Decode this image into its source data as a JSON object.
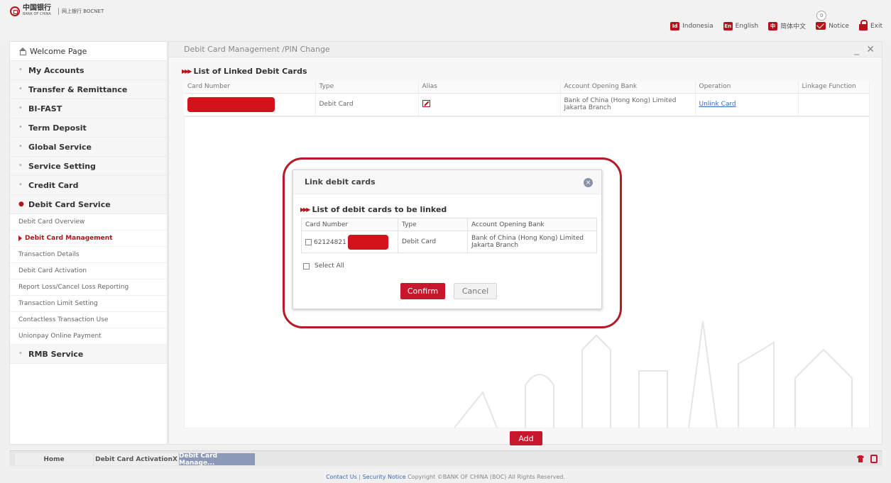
{
  "header": {
    "logo_cn": "中国银行",
    "logo_en": "BANK OF CHINA",
    "logo_sub": "网上银行 BOCNET",
    "notice_count": "0",
    "links": [
      {
        "badge": "Id",
        "label": "Indonesia"
      },
      {
        "badge": "En",
        "label": "English"
      },
      {
        "badge": "中",
        "label": "简体中文"
      }
    ],
    "notice_label": "Notice",
    "exit_label": "Exit"
  },
  "sidebar": {
    "welcome": "Welcome Page",
    "items": [
      "My Accounts",
      "Transfer & Remittance",
      "BI-FAST",
      "Term Deposit",
      "Global Service",
      "Service Setting",
      "Credit Card",
      "Debit Card Service"
    ],
    "sub_items": [
      "Debit Card Overview",
      "Debit Card Management",
      "Transaction Details",
      "Debit Card Activation",
      "Report Loss/Cancel Loss Reporting",
      "Transaction Limit Setting",
      "Contactless Transaction Use",
      "Unionpay Online Payment"
    ],
    "last_item": "RMB Service"
  },
  "main": {
    "breadcrumb": "Debit Card Management /PIN Change",
    "minimize": "_",
    "close": "✕",
    "section_title": "List of Linked Debit Cards",
    "columns": [
      "Card Number",
      "Type",
      "Alias",
      "Account Opening Bank",
      "Operation",
      "Linkage Function"
    ],
    "row": {
      "type": "Debit Card",
      "bank": "Bank of China (Hong Kong) Limited Jakarta Branch",
      "operation": "Unlink Card"
    },
    "add_button": "Add"
  },
  "modal": {
    "title": "Link debit cards",
    "close": "×",
    "section_title": "List of debit cards to be linked",
    "columns": [
      "Card Number",
      "Type",
      "Account Opening Bank"
    ],
    "row": {
      "card_prefix": "62124821",
      "type": "Debit Card",
      "bank": "Bank of China (Hong Kong) Limited Jakarta Branch"
    },
    "select_all": "Select All",
    "confirm": "Confirm",
    "cancel": "Cancel"
  },
  "tabs": {
    "home": "Home",
    "activation": "Debit Card ActivationX",
    "management": "Debit Card Manage..."
  },
  "footer": {
    "contact": "Contact Us",
    "separator": "|",
    "security": "Security Notice",
    "copyright": "Copyright ©BANK OF CHINA (BOC) All Rights Reserved."
  },
  "colors": {
    "brand_red": "#c8162c",
    "link_blue": "#3a6bb5",
    "tab_active": "#8d99b8"
  }
}
